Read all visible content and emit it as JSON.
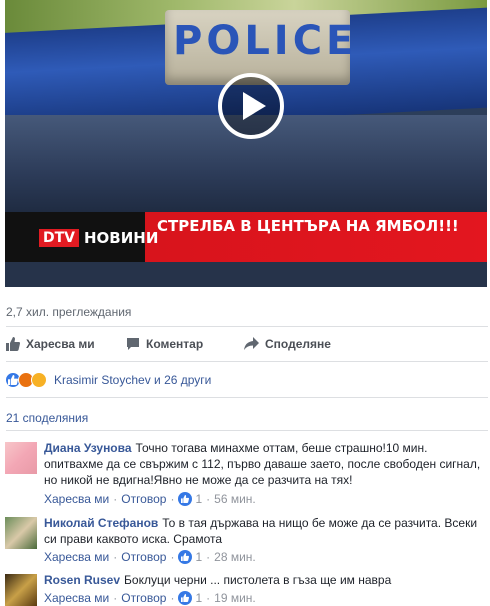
{
  "video": {
    "plate_text": "POLICE",
    "logo_dtv": "DTV",
    "logo_news": "НОВИНИ",
    "headline": "СТРЕЛБА В ЦЕНТЪРА НА ЯМБОЛ!!!",
    "play_icon": "play-icon"
  },
  "stats": {
    "views": "2,7 хил. преглеждания"
  },
  "actions": {
    "like": "Харесва ми",
    "comment": "Коментар",
    "share": "Споделяне"
  },
  "reactions": {
    "text": "Krasimir Stoychev и 26 други",
    "icons": [
      "like",
      "angry",
      "wow"
    ]
  },
  "shares": "21 споделяния",
  "comments": [
    {
      "author": "Диана Узунова",
      "text": "Точно тогава минахме оттам, беше страшно!10 мин. опитвахме да се свържим с 112, първо даваше заето, после свободен сигнал, но никой не вдигна!Явно не може да се разчита на тях!",
      "like": "Харесва ми",
      "reply": "Отговор",
      "likes": "1",
      "time": "56 мин."
    },
    {
      "author": "Николай Стефанов",
      "text": "То в тая държава на нищо бе може да се разчита. Всеки си прави каквото иска. Срамота",
      "like": "Харесва ми",
      "reply": "Отговор",
      "likes": "1",
      "time": "28 мин."
    },
    {
      "author": "Rosen Rusev",
      "text": "Боклуци черни ... пистолета в гъза ще им навра",
      "like": "Харесва ми",
      "reply": "Отговор",
      "likes": "1",
      "time": "19 мин."
    }
  ],
  "colors": {
    "link": "#385898",
    "meta": "#90949c",
    "like_blue": "#3578e5",
    "banner_red": "#e3161f"
  }
}
